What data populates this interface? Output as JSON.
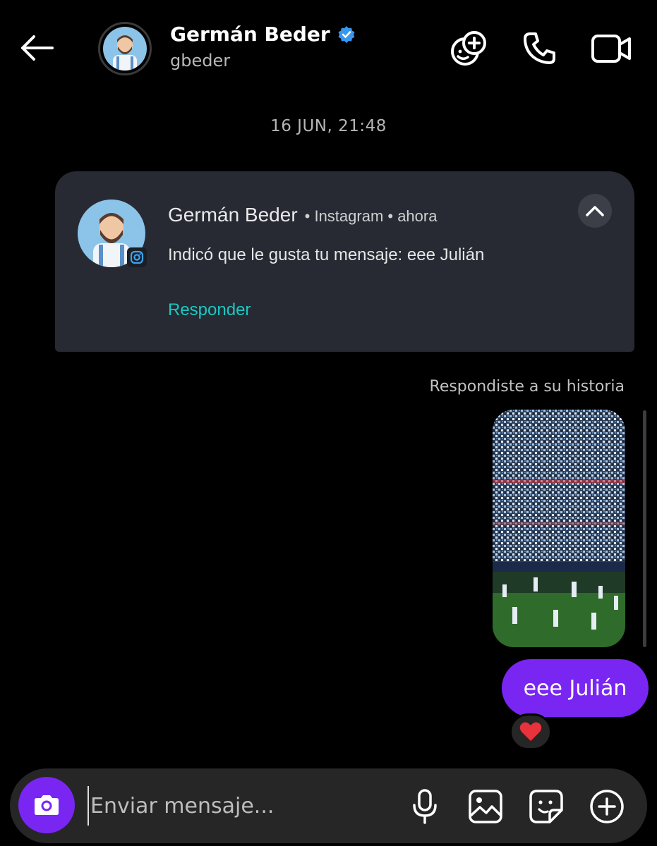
{
  "header": {
    "name": "Germán Beder",
    "username": "gbeder",
    "icons": [
      "back-arrow-icon",
      "verified-badge-icon",
      "add-effects-icon",
      "phone-icon",
      "video-icon"
    ]
  },
  "timestamp": "16 JUN, 21:48",
  "notification": {
    "sender": "Germán Beder",
    "meta": "• Instagram • ahora",
    "body": "Indicó que le gusta tu mensaje: eee Julián",
    "reply_label": "Responder",
    "colors": {
      "card": "#272a33",
      "reply": "#19c9c2"
    }
  },
  "story_reply": {
    "label": "Respondiste a su historia"
  },
  "message": {
    "text": "eee Julián",
    "reaction": "❤️",
    "bubble_color": "#7a26f3"
  },
  "composer": {
    "placeholder": "Enviar mensaje...",
    "icons": [
      "camera-icon",
      "microphone-icon",
      "gallery-icon",
      "sticker-icon",
      "plus-icon"
    ]
  }
}
